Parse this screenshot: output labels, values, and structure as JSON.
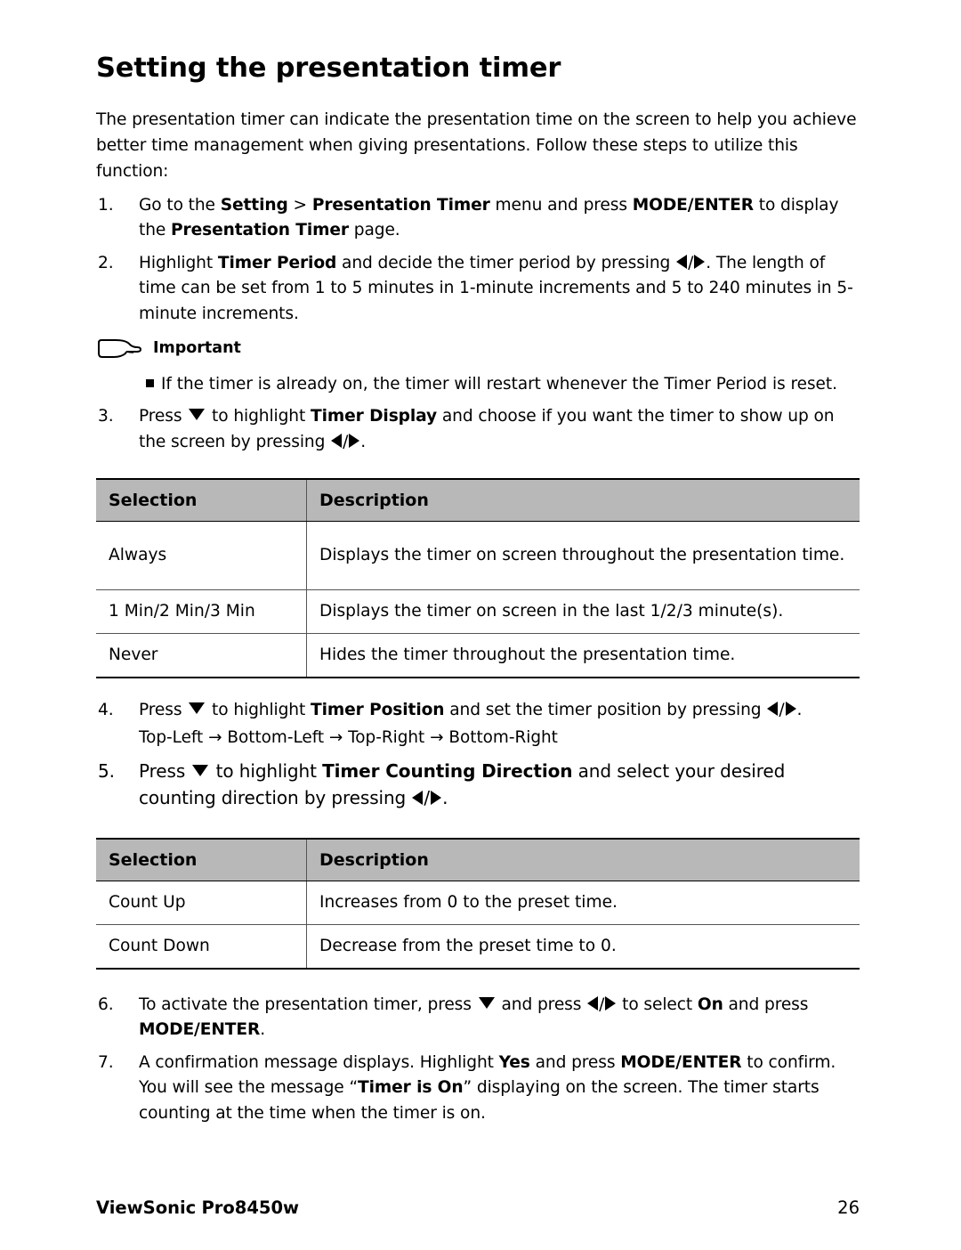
{
  "page": {
    "title": "Setting the presentation timer",
    "intro": "The presentation timer can indicate the presentation time on the screen to help you achieve better time management when giving presentations. Follow these steps to utilize this function:",
    "footer_brand": "ViewSonic",
    "footer_model": "Pro8450w",
    "footer_page": "26"
  },
  "steps": {
    "s1": {
      "num": "1.",
      "p1": "Go to the ",
      "b1": "Setting",
      "p2": " > ",
      "b2": "Presentation Timer",
      "p3": " menu and press ",
      "b3": "MODE/ENTER",
      "p4": " to display the ",
      "b4": "Presentation Timer",
      "p5": " page."
    },
    "s2": {
      "num": "2.",
      "p1": "Highlight ",
      "b1": "Timer Period",
      "p2": " and decide the timer period by pressing ",
      "sep": "/",
      "p3": ". The length of time can be set from 1 to 5 minutes in 1-minute increments and 5 to 240 minutes in 5-minute increments."
    },
    "s3": {
      "num": "3.",
      "p1": "Press ",
      "p2": " to highlight ",
      "b1": "Timer Display",
      "p3": " and choose if you want the timer to show up on the screen by pressing ",
      "sep": "/",
      "p4": "."
    },
    "s4": {
      "num": "4.",
      "p1": "Press ",
      "p2": " to highlight ",
      "b1": "Timer Position",
      "p3": " and set the timer position by pressing ",
      "sep": "/",
      "p4": ".",
      "positions": "Top-Left → Bottom-Left → Top-Right → Bottom-Right"
    },
    "s5": {
      "num": "5.",
      "p1": "Press ",
      "p2": " to highlight ",
      "b1": "Timer Counting Direction",
      "p3": " and select your desired counting direction by pressing ",
      "sep": "/",
      "p4": "."
    },
    "s6": {
      "num": "6.",
      "p1": "To activate the presentation timer, press ",
      "p2": " and press ",
      "sep": "/",
      "p3": " to select ",
      "b1": "On",
      "p4": " and press ",
      "b2": "MODE/ENTER",
      "p5": "."
    },
    "s7": {
      "num": "7.",
      "p1": "A confirmation message displays. Highlight ",
      "b1": "Yes",
      "p2": " and press ",
      "b2": "MODE/ENTER",
      "p3": " to confirm. You will see the message “",
      "b3": "Timer is On",
      "p4": "” displaying on the  screen. The timer starts counting at the time when the timer is on."
    }
  },
  "important": {
    "label": "Important",
    "bullet": "If the timer is already on, the timer will restart whenever the Timer Period is reset."
  },
  "table_display": {
    "headers": [
      "Selection",
      "Description"
    ],
    "rows": [
      [
        "Always",
        "Displays the timer on screen throughout the presentation time."
      ],
      [
        "1 Min/2 Min/3 Min",
        "Displays the timer on screen in the last 1/2/3 minute(s)."
      ],
      [
        "Never",
        "Hides the timer throughout the presentation time."
      ]
    ]
  },
  "table_direction": {
    "headers": [
      "Selection",
      "Description"
    ],
    "rows": [
      [
        "Count Up",
        "Increases from 0 to the preset time."
      ],
      [
        "Count Down",
        "Decrease from the preset time to 0."
      ]
    ]
  },
  "colors": {
    "table_header_bg": "#b8b8b8",
    "text": "#000000"
  }
}
